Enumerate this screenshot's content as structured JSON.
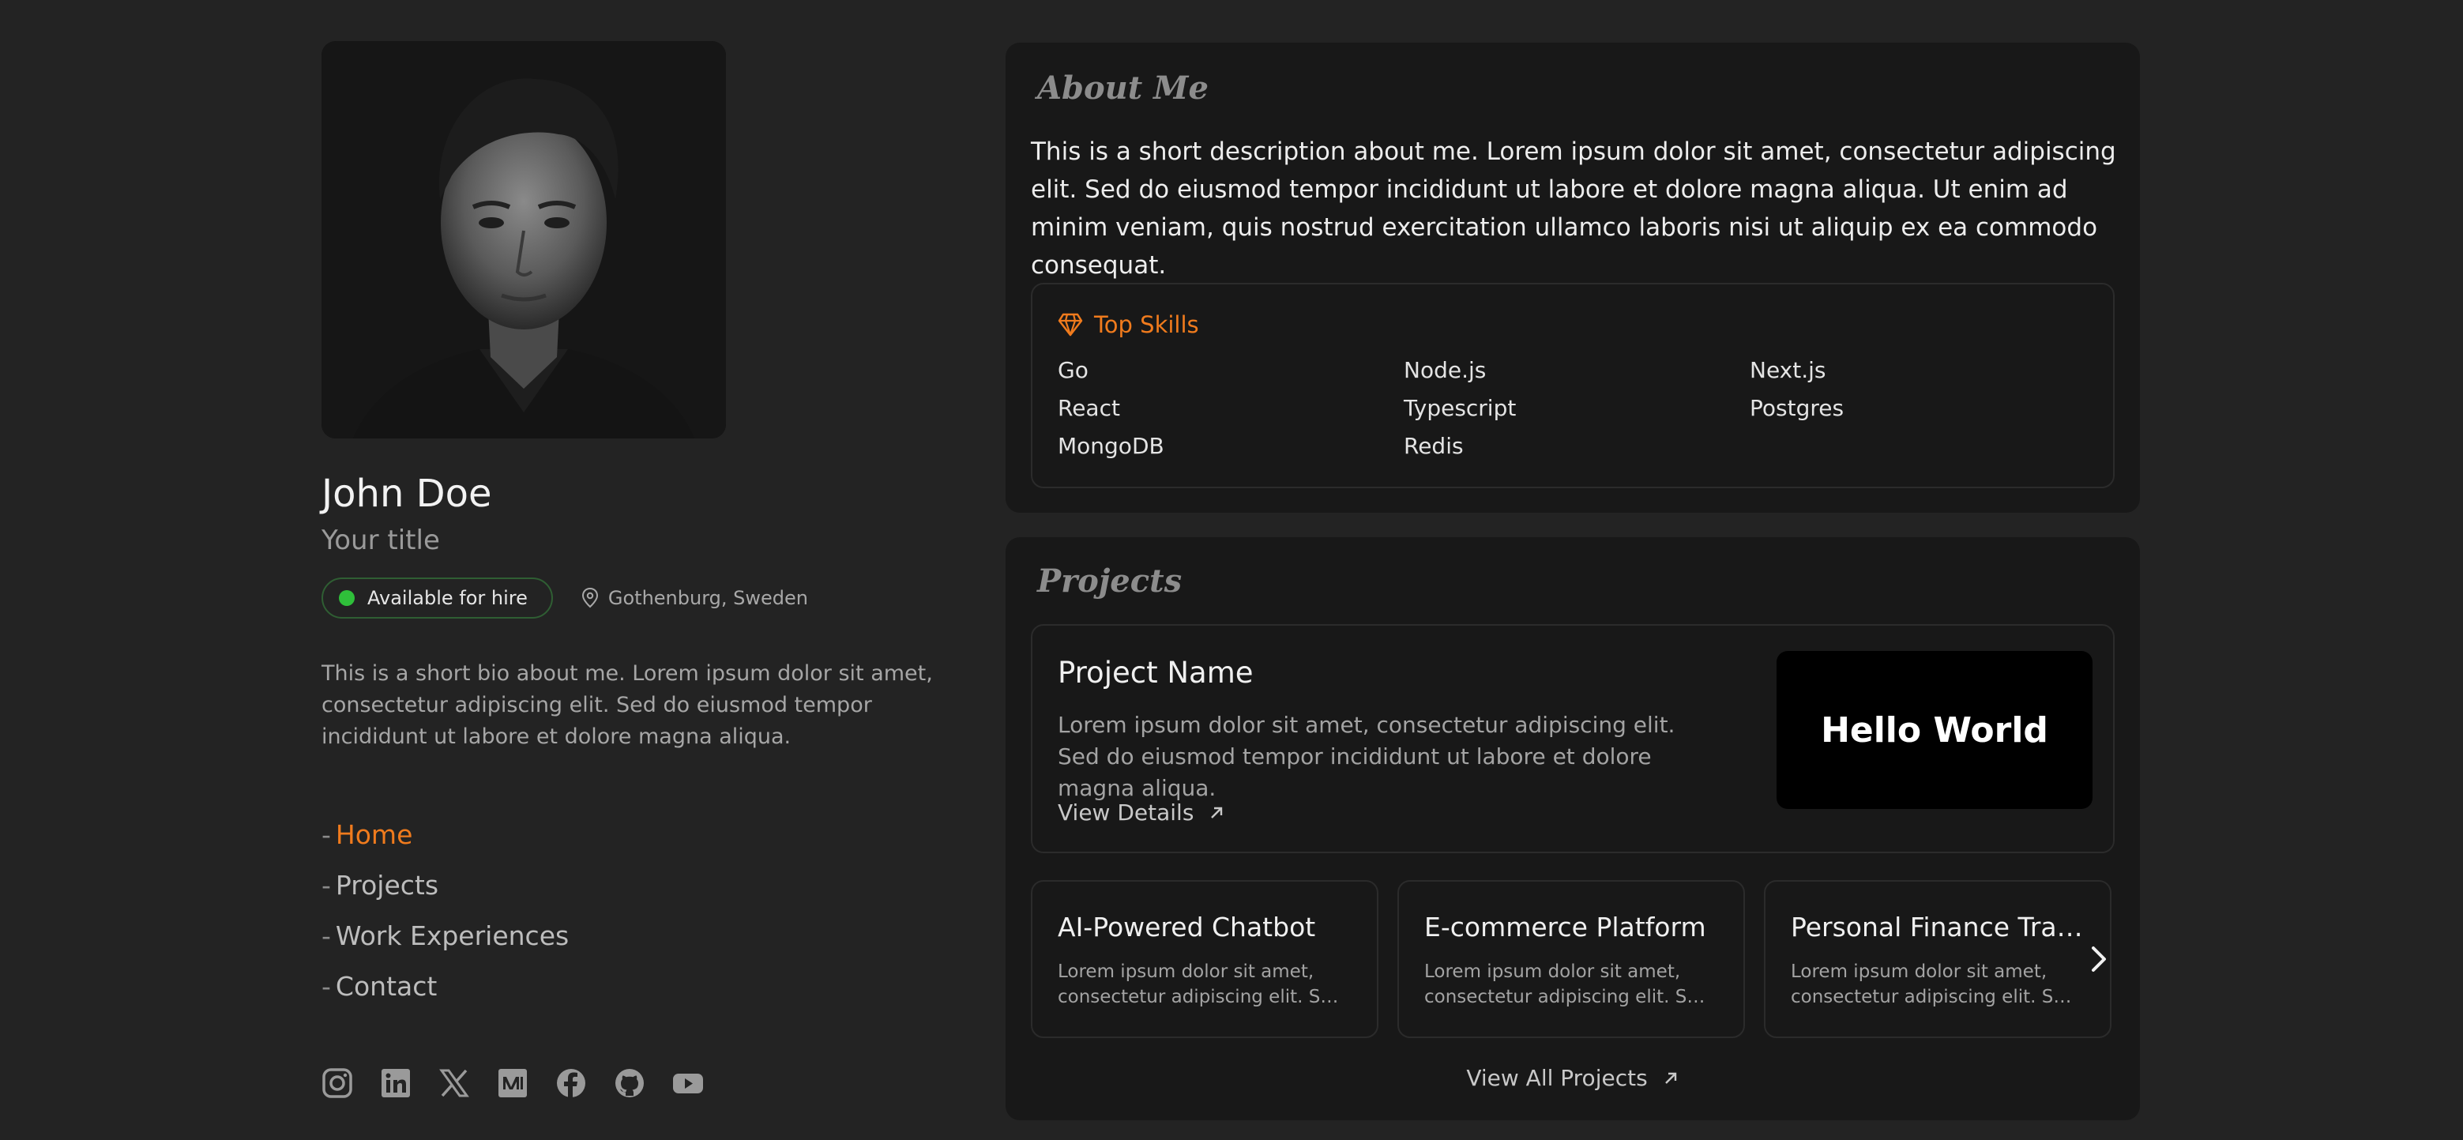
{
  "profile": {
    "name": "John Doe",
    "title": "Your title",
    "availability": "Available for hire",
    "location": "Gothenburg, Sweden",
    "bio": "This is a short bio about me. Lorem ipsum dolor sit amet, consectetur adipiscing elit. Sed do eiusmod tempor incididunt ut labore et dolore magna aliqua."
  },
  "nav": {
    "items": [
      {
        "label": "Home",
        "active": true
      },
      {
        "label": "Projects",
        "active": false
      },
      {
        "label": "Work Experiences",
        "active": false
      },
      {
        "label": "Contact",
        "active": false
      }
    ]
  },
  "socials": [
    "instagram-icon",
    "linkedin-icon",
    "x-icon",
    "medium-icon",
    "facebook-icon",
    "github-icon",
    "youtube-icon"
  ],
  "about": {
    "title": "About Me",
    "text": "This is a short description about me. Lorem ipsum dolor sit amet, consectetur adipiscing elit. Sed do eiusmod tempor incididunt ut labore et dolore magna aliqua. Ut enim ad minim veniam, quis nostrud exercitation ullamco laboris nisi ut aliquip ex ea commodo consequat.",
    "skills_title": "Top Skills",
    "skills": [
      "Go",
      "Node.js",
      "Next.js",
      "React",
      "Typescript",
      "Postgres",
      "MongoDB",
      "Redis"
    ]
  },
  "projects": {
    "title": "Projects",
    "featured": {
      "name": "Project Name",
      "description": "Lorem ipsum dolor sit amet, consectetur adipiscing elit. Sed do eiusmod tempor incididunt ut labore et dolore magna aliqua.",
      "link": "View Details",
      "thumb_text": "Hello World"
    },
    "cards": [
      {
        "name": "AI-Powered Chatbot",
        "line1": "Lorem ipsum dolor sit amet,",
        "line2": "consectetur adipiscing elit. Sed..."
      },
      {
        "name": "E-commerce Platform",
        "line1": "Lorem ipsum dolor sit amet,",
        "line2": "consectetur adipiscing elit. Sed..."
      },
      {
        "name": "Personal Finance Track...",
        "line1": "Lorem ipsum dolor sit amet,",
        "line2": "consectetur adipiscing elit. Sed..."
      }
    ],
    "view_all": "View All Projects"
  },
  "colors": {
    "background": "#232323",
    "panel": "#181818",
    "accent": "#f07b1d",
    "available": "#2fbf3a"
  }
}
